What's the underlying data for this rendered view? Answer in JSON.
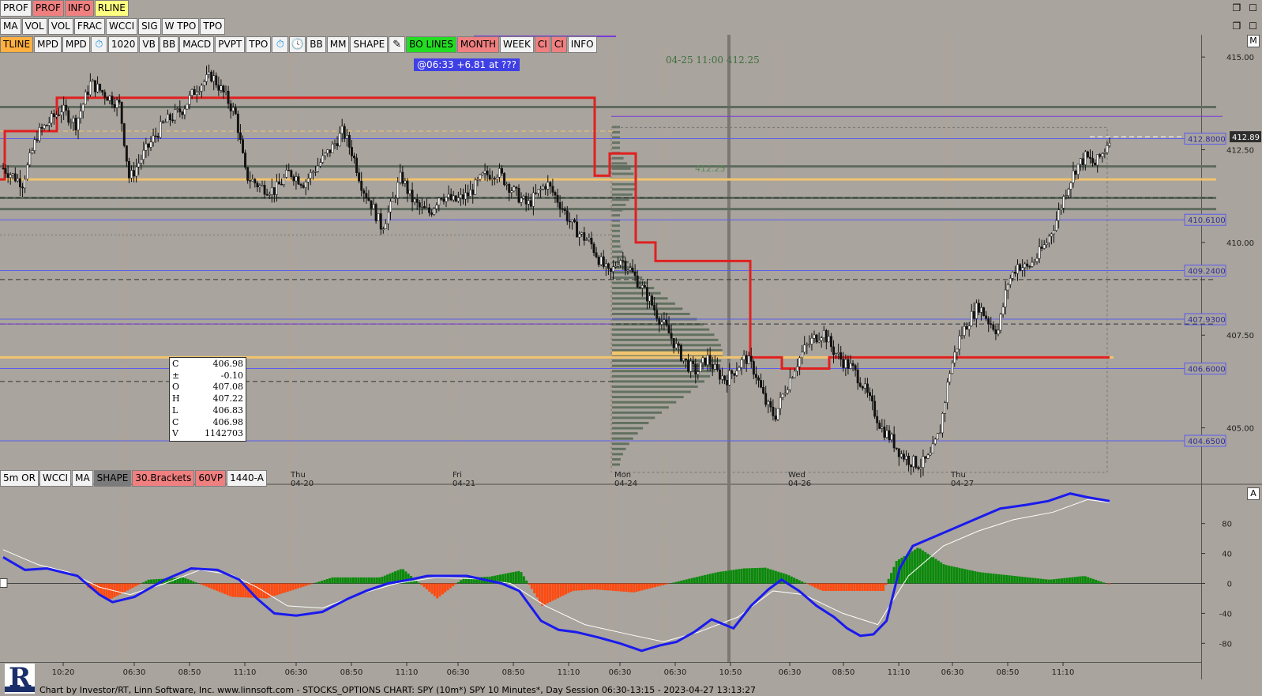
{
  "toolbar_row1": [
    {
      "label": "PROF",
      "color": "default"
    },
    {
      "label": "PROF",
      "color": "pink"
    },
    {
      "label": "INFO",
      "color": "pink"
    },
    {
      "label": "RLINE",
      "color": "yellow"
    }
  ],
  "toolbar_row2": [
    {
      "label": "MA"
    },
    {
      "label": "VOL"
    },
    {
      "label": "VOL"
    },
    {
      "label": "FRAC"
    },
    {
      "label": "WCCI"
    },
    {
      "label": "SIG"
    },
    {
      "label": "W TPO"
    },
    {
      "label": "TPO"
    }
  ],
  "toolbar_row3": [
    {
      "label": "TLINE",
      "color": "orange"
    },
    {
      "label": "MPD"
    },
    {
      "label": "MPD"
    },
    {
      "icon": "stopwatch-icon",
      "glyph": "⏱",
      "color": "blue"
    },
    {
      "label": "1020"
    },
    {
      "label": "VB"
    },
    {
      "label": "BB"
    },
    {
      "label": "MACD"
    },
    {
      "label": "PVPT"
    },
    {
      "label": "TPO"
    },
    {
      "icon": "stopwatch-icon",
      "glyph": "⏱",
      "color": "blue"
    },
    {
      "icon": "clock-icon",
      "glyph": "🕓",
      "color": "blue"
    },
    {
      "label": "BB"
    },
    {
      "label": "MM"
    },
    {
      "label": "SHAPE"
    },
    {
      "icon": "pencil-icon",
      "glyph": "✎",
      "color": "dark"
    },
    {
      "label": "BO LINES",
      "color": "green"
    },
    {
      "label": "MONTH",
      "color": "pink"
    },
    {
      "label": "WEEK"
    },
    {
      "label": "CI",
      "color": "pink"
    },
    {
      "label": "CI",
      "color": "pink"
    },
    {
      "label": "INFO"
    }
  ],
  "toolbar_bottom": [
    {
      "label": "5m OR"
    },
    {
      "label": "WCCI"
    },
    {
      "label": "MA"
    },
    {
      "label": "SHAPE",
      "color": "gray"
    },
    {
      "label": "30.Brackets",
      "color": "pink"
    },
    {
      "label": "60VP",
      "color": "pink"
    },
    {
      "label": "1440-A"
    }
  ],
  "tooltip": "@06:33  +6.81 at ???",
  "cursor_timestamp": "04-25 11:00  412.25",
  "poc_label": "412.25",
  "ohlc": [
    {
      "k": "C",
      "v": "406.98"
    },
    {
      "k": "±",
      "v": "-0.10"
    },
    {
      "k": "O",
      "v": "407.08"
    },
    {
      "k": "H",
      "v": "407.22"
    },
    {
      "k": "L",
      "v": "406.83"
    },
    {
      "k": "C",
      "v": "406.98"
    },
    {
      "k": "V",
      "v": "1142703"
    }
  ],
  "pane_tags": {
    "main": "M",
    "indicator": "A"
  },
  "footer": "Chart by Investor/RT, Linn Software, Inc. www.linnsoft.com - STOCKS_OPTIONS CHART: SPY (10m*) SPY 10 Minutes*, Day Session 06:30-13:15 - 2023-04-27 13:13:27",
  "logo_letter": "R",
  "chart_data": {
    "type": "candlestick",
    "price_axis": {
      "ylim": [
        403.5,
        415.6
      ],
      "ticks": [
        "415.00",
        "412.50",
        "410.00",
        "407.50",
        "405.00"
      ],
      "price_tag": "412.89"
    },
    "level_lines": [
      {
        "label": "412.8000",
        "price": 412.8
      },
      {
        "label": "410.6100",
        "price": 410.61
      },
      {
        "label": "409.2400",
        "price": 409.24
      },
      {
        "label": "407.9300",
        "price": 407.93
      },
      {
        "label": "406.6000",
        "price": 406.6
      },
      {
        "label": "404.6500",
        "price": 404.65
      }
    ],
    "day_labels": [
      {
        "day": "Thu",
        "date": "04-20"
      },
      {
        "day": "Fri",
        "date": "04-21"
      },
      {
        "day": "Mon",
        "date": "04-24"
      },
      {
        "day": "Wed",
        "date": "04-26"
      },
      {
        "day": "Thu",
        "date": "04-27"
      }
    ],
    "close_path": [
      [
        0,
        412.0
      ],
      [
        8,
        411.6
      ],
      [
        14,
        412.9
      ],
      [
        24,
        413.6
      ],
      [
        30,
        413.2
      ],
      [
        36,
        414.3
      ],
      [
        42,
        414.0
      ],
      [
        48,
        413.7
      ],
      [
        52,
        411.7
      ],
      [
        58,
        412.4
      ],
      [
        66,
        413.2
      ],
      [
        74,
        413.6
      ],
      [
        80,
        414.2
      ],
      [
        86,
        414.5
      ],
      [
        92,
        413.9
      ],
      [
        96,
        413.4
      ],
      [
        100,
        411.8
      ],
      [
        106,
        411.5
      ],
      [
        112,
        411.4
      ],
      [
        118,
        411.9
      ],
      [
        124,
        411.6
      ],
      [
        130,
        412.1
      ],
      [
        136,
        412.6
      ],
      [
        140,
        413.0
      ],
      [
        144,
        412.4
      ],
      [
        148,
        411.5
      ],
      [
        152,
        411.0
      ],
      [
        156,
        410.4
      ],
      [
        160,
        411.0
      ],
      [
        164,
        411.8
      ],
      [
        168,
        411.2
      ],
      [
        172,
        410.9
      ],
      [
        176,
        410.8
      ],
      [
        180,
        411.3
      ],
      [
        186,
        411.1
      ],
      [
        192,
        411.3
      ],
      [
        198,
        411.8
      ],
      [
        204,
        411.9
      ],
      [
        210,
        411.4
      ],
      [
        216,
        411.0
      ],
      [
        220,
        411.3
      ],
      [
        224,
        411.6
      ],
      [
        230,
        411.0
      ],
      [
        234,
        410.5
      ],
      [
        238,
        410.2
      ],
      [
        242,
        410.0
      ],
      [
        246,
        409.5
      ],
      [
        250,
        409.1
      ],
      [
        254,
        409.6
      ],
      [
        258,
        409.3
      ],
      [
        262,
        408.9
      ],
      [
        266,
        408.5
      ],
      [
        270,
        408.0
      ],
      [
        274,
        407.6
      ],
      [
        278,
        407.1
      ],
      [
        282,
        406.7
      ],
      [
        286,
        406.5
      ],
      [
        290,
        406.9
      ],
      [
        294,
        406.5
      ],
      [
        298,
        406.3
      ],
      [
        302,
        406.6
      ],
      [
        306,
        406.9
      ],
      [
        310,
        406.5
      ],
      [
        314,
        405.7
      ],
      [
        318,
        405.3
      ],
      [
        322,
        406.0
      ],
      [
        326,
        406.6
      ],
      [
        330,
        407.1
      ],
      [
        334,
        407.4
      ],
      [
        338,
        407.6
      ],
      [
        342,
        407.1
      ],
      [
        346,
        406.8
      ],
      [
        350,
        406.6
      ],
      [
        354,
        406.2
      ],
      [
        358,
        405.6
      ],
      [
        362,
        405.0
      ],
      [
        366,
        404.7
      ],
      [
        370,
        404.3
      ],
      [
        374,
        404.1
      ],
      [
        378,
        404.0
      ],
      [
        382,
        404.2
      ],
      [
        386,
        404.9
      ],
      [
        390,
        406.5
      ],
      [
        394,
        407.4
      ],
      [
        398,
        407.9
      ],
      [
        402,
        408.3
      ],
      [
        406,
        407.9
      ],
      [
        410,
        407.6
      ],
      [
        414,
        408.9
      ],
      [
        418,
        409.4
      ],
      [
        422,
        409.3
      ],
      [
        426,
        409.6
      ],
      [
        430,
        410.0
      ],
      [
        434,
        410.6
      ],
      [
        438,
        411.4
      ],
      [
        442,
        412.0
      ],
      [
        446,
        412.3
      ],
      [
        450,
        412.1
      ],
      [
        454,
        412.5
      ],
      [
        456,
        412.85
      ]
    ],
    "bar_count": 458,
    "indicator": {
      "ticks": [
        "80",
        "40",
        "0",
        "-40",
        "-80"
      ],
      "ylim": [
        -105,
        125
      ],
      "wcci_blue": [
        [
          0,
          35
        ],
        [
          10,
          18
        ],
        [
          20,
          20
        ],
        [
          34,
          10
        ],
        [
          44,
          -15
        ],
        [
          50,
          -25
        ],
        [
          60,
          -18
        ],
        [
          74,
          5
        ],
        [
          86,
          20
        ],
        [
          98,
          18
        ],
        [
          108,
          5
        ],
        [
          116,
          -20
        ],
        [
          124,
          -40
        ],
        [
          134,
          -43
        ],
        [
          146,
          -38
        ],
        [
          158,
          -20
        ],
        [
          166,
          -10
        ],
        [
          176,
          0
        ],
        [
          186,
          5
        ],
        [
          194,
          10
        ],
        [
          202,
          10
        ],
        [
          212,
          10
        ],
        [
          220,
          5
        ],
        [
          228,
          0
        ],
        [
          236,
          -10
        ],
        [
          246,
          -50
        ],
        [
          254,
          -62
        ],
        [
          262,
          -65
        ],
        [
          272,
          -72
        ],
        [
          282,
          -80
        ],
        [
          292,
          -90
        ],
        [
          300,
          -83
        ],
        [
          308,
          -78
        ],
        [
          316,
          -65
        ],
        [
          324,
          -48
        ],
        [
          334,
          -60
        ],
        [
          342,
          -30
        ],
        [
          350,
          -8
        ],
        [
          356,
          5
        ],
        [
          364,
          -10
        ],
        [
          372,
          -30
        ],
        [
          380,
          -45
        ],
        [
          386,
          -60
        ],
        [
          392,
          -70
        ],
        [
          398,
          -68
        ],
        [
          404,
          -50
        ],
        [
          410,
          20
        ],
        [
          416,
          50
        ],
        [
          424,
          60
        ],
        [
          436,
          75
        ],
        [
          448,
          90
        ],
        [
          456,
          100
        ],
        [
          468,
          105
        ],
        [
          478,
          110
        ],
        [
          488,
          120
        ],
        [
          496,
          115
        ],
        [
          506,
          110
        ]
      ],
      "signal_white": [
        [
          0,
          45
        ],
        [
          16,
          25
        ],
        [
          30,
          15
        ],
        [
          44,
          -5
        ],
        [
          58,
          -15
        ],
        [
          74,
          0
        ],
        [
          90,
          18
        ],
        [
          104,
          12
        ],
        [
          116,
          -5
        ],
        [
          130,
          -30
        ],
        [
          146,
          -33
        ],
        [
          162,
          -15
        ],
        [
          180,
          0
        ],
        [
          198,
          8
        ],
        [
          216,
          6
        ],
        [
          232,
          0
        ],
        [
          248,
          -30
        ],
        [
          266,
          -55
        ],
        [
          286,
          -68
        ],
        [
          302,
          -78
        ],
        [
          318,
          -65
        ],
        [
          336,
          -45
        ],
        [
          352,
          -10
        ],
        [
          366,
          -15
        ],
        [
          384,
          -40
        ],
        [
          400,
          -55
        ],
        [
          414,
          10
        ],
        [
          430,
          50
        ],
        [
          446,
          70
        ],
        [
          462,
          85
        ],
        [
          480,
          95
        ],
        [
          496,
          112
        ],
        [
          506,
          108
        ]
      ],
      "histogram_peaks": [
        [
          38,
          -5
        ],
        [
          48,
          -22
        ],
        [
          66,
          5
        ],
        [
          82,
          8
        ],
        [
          104,
          -18
        ],
        [
          120,
          -20
        ],
        [
          150,
          8
        ],
        [
          172,
          8
        ],
        [
          182,
          20
        ],
        [
          198,
          -20
        ],
        [
          210,
          7
        ],
        [
          222,
          9
        ],
        [
          236,
          17
        ],
        [
          246,
          -30
        ],
        [
          260,
          -10
        ],
        [
          270,
          -8
        ],
        [
          288,
          -12
        ],
        [
          310,
          4
        ],
        [
          326,
          15
        ],
        [
          338,
          20
        ],
        [
          348,
          21
        ],
        [
          358,
          12
        ],
        [
          374,
          -10
        ],
        [
          392,
          -10
        ],
        [
          402,
          -10
        ],
        [
          408,
          30
        ],
        [
          418,
          48
        ],
        [
          430,
          25
        ],
        [
          446,
          15
        ],
        [
          462,
          10
        ],
        [
          478,
          5
        ],
        [
          494,
          10
        ],
        [
          506,
          -2
        ]
      ]
    }
  }
}
